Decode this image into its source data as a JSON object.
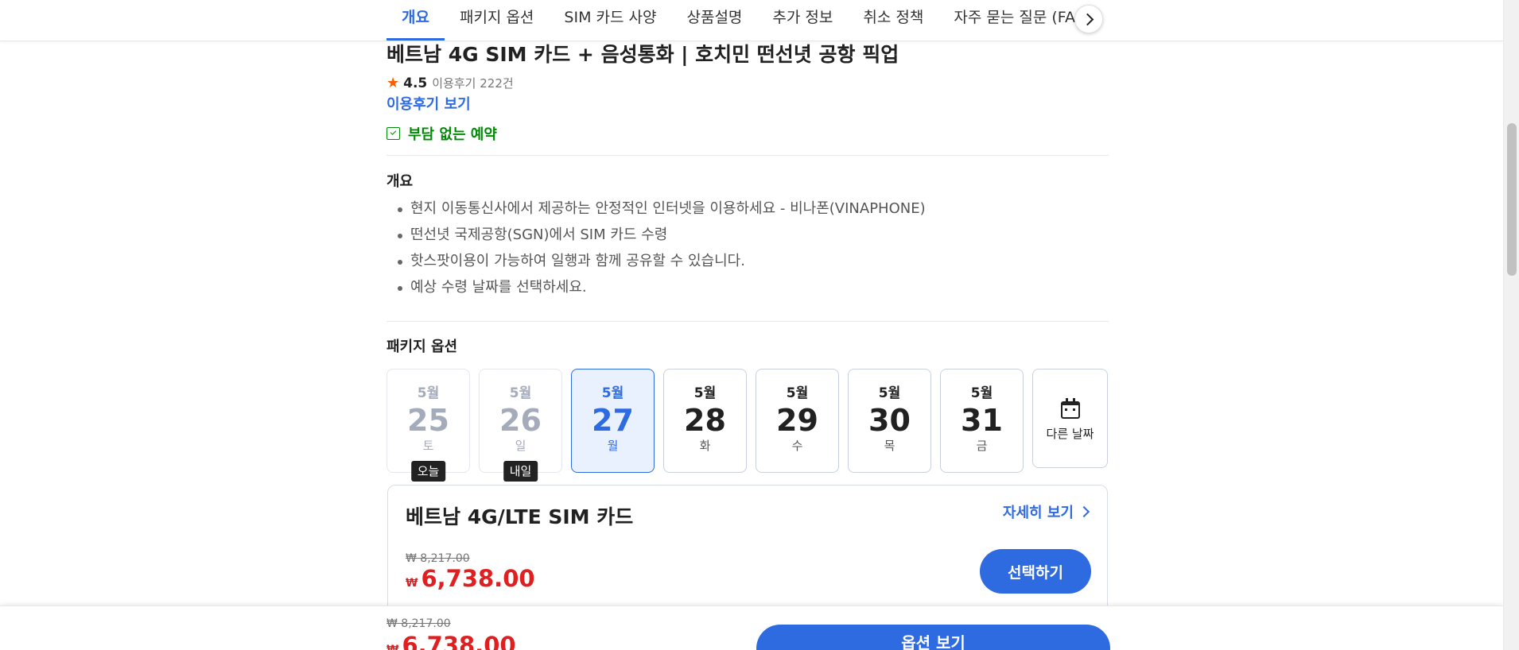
{
  "tabs": [
    {
      "label": "개요",
      "active": true
    },
    {
      "label": "패키지 옵션"
    },
    {
      "label": "SIM 카드 사양"
    },
    {
      "label": "상품설명"
    },
    {
      "label": "추가 정보"
    },
    {
      "label": "취소 정책"
    },
    {
      "label": "자주 묻는 질문 (FAQ)"
    }
  ],
  "product": {
    "title": "베트남 4G SIM 카드 + 음성통화 | 호치민 떤선녓 공항 픽업",
    "rating": "4.5",
    "review_count": "이용후기 222건",
    "review_link": "이용후기 보기",
    "free_booking": "부담 없는 예약"
  },
  "overview": {
    "heading": "개요",
    "items": [
      "현지 이동통신사에서 제공하는 안정적인 인터넷을 이용하세요 - 비나폰(VINAPHONE)",
      "떤선녓 국제공항(SGN)에서 SIM 카드 수령",
      "핫스팟이용이 가능하여 일행과 함께 공유할 수 있습니다.",
      "예상 수령 날짜를 선택하세요."
    ]
  },
  "package": {
    "heading": "패키지 옵션",
    "dates": [
      {
        "month": "5월",
        "day": "25",
        "weekday": "토",
        "badge": "오늘",
        "state": "disabled"
      },
      {
        "month": "5월",
        "day": "26",
        "weekday": "일",
        "badge": "내일",
        "state": "disabled"
      },
      {
        "month": "5월",
        "day": "27",
        "weekday": "월",
        "state": "selected"
      },
      {
        "month": "5월",
        "day": "28",
        "weekday": "화",
        "state": "normal"
      },
      {
        "month": "5월",
        "day": "29",
        "weekday": "수",
        "state": "normal"
      },
      {
        "month": "5월",
        "day": "30",
        "weekday": "목",
        "state": "normal"
      },
      {
        "month": "5월",
        "day": "31",
        "weekday": "금",
        "state": "normal"
      }
    ],
    "other_date_label": "다른 날짜"
  },
  "card": {
    "title": "베트남 4G/LTE SIM 카드",
    "more_label": "자세히 보기",
    "original_price": "₩ 8,217.00",
    "currency": "₩",
    "price": "6,738.00",
    "select_label": "선택하기"
  },
  "bottom_bar": {
    "original_price": "₩ 8,217.00",
    "currency": "₩",
    "price": "6,738.00",
    "button_label": "옵션 보기"
  },
  "colors": {
    "accent": "#2f6be0",
    "price_red": "#e02020",
    "success_green": "#008a05",
    "star_orange": "#ff5b00"
  }
}
